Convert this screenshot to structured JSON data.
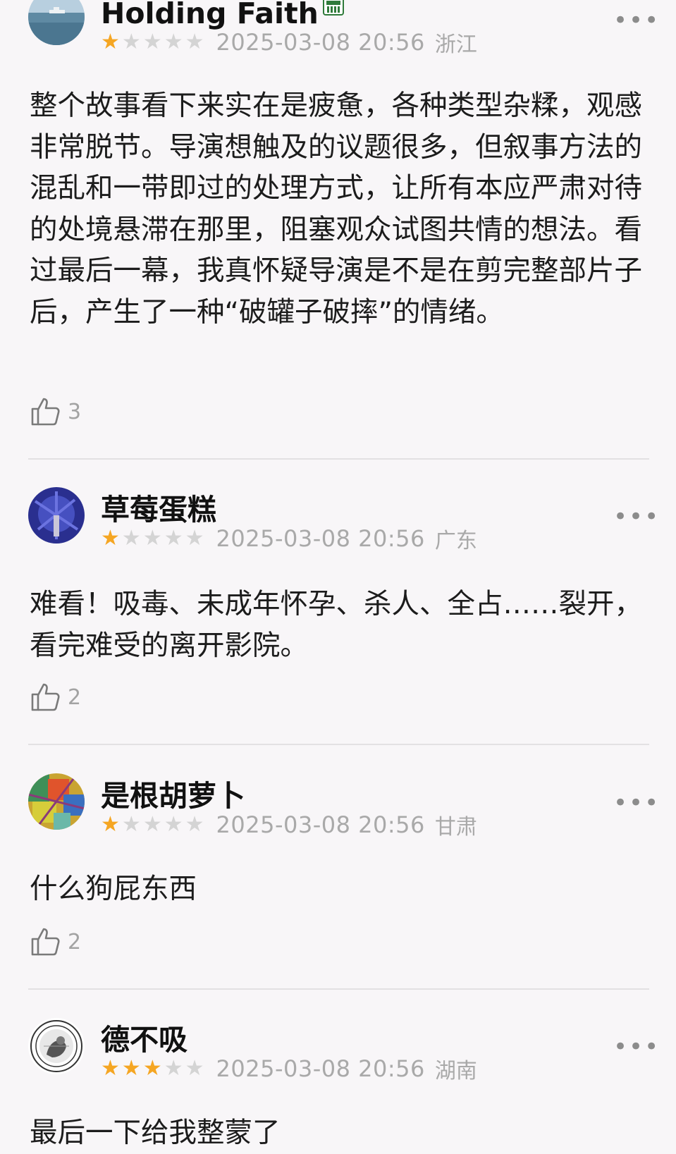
{
  "reviews": [
    {
      "username": "Holding Faith",
      "avatar": "avatar-sea-landscape",
      "badge_icon": "member-badge-icon",
      "rating": 1,
      "rating_max": 5,
      "time": "2025-03-08 20:56",
      "location": "浙江",
      "text": "整个故事看下来实在是疲惫，各种类型杂糅，观感非常脱节。导演想触及的议题很多，但叙事方法的混乱和一带即过的处理方式，让所有本应严肃对待的处境悬滞在那里，阻塞观众试图共情的想法。看过最后一幕，我真怀疑导演是不是在剪完整部片子后，产生了一种“破罐子破摔”的情绪。",
      "likes": "3"
    },
    {
      "username": "草莓蛋糕",
      "avatar": "avatar-blue-painting",
      "rating": 1,
      "rating_max": 5,
      "time": "2025-03-08 20:56",
      "location": "广东",
      "text": "难看！吸毒、未成年怀孕、杀人、全占……裂开，看完难受的离开影院。",
      "likes": "2"
    },
    {
      "username": "是根胡萝卜",
      "avatar": "avatar-colorful-abstract",
      "rating": 1,
      "rating_max": 5,
      "time": "2025-03-08 20:56",
      "location": "甘肃",
      "text": "什么狗屁东西",
      "likes": "2"
    },
    {
      "username": "德不吸",
      "avatar": "avatar-seal-emblem",
      "rating": 3,
      "rating_max": 5,
      "time": "2025-03-08 20:56",
      "location": "湖南",
      "text": "最后一下给我整蒙了",
      "likes": ""
    }
  ],
  "icons": {
    "star": "star-icon",
    "like": "thumbs-up-icon",
    "more": "more-dots-icon"
  },
  "more_label": "•••",
  "colors": {
    "background": "#f8f6f8",
    "star_on": "#f5a623",
    "star_off": "#d4d4d4",
    "meta_text": "#a9a9a9",
    "divider": "#e3e1e3"
  }
}
